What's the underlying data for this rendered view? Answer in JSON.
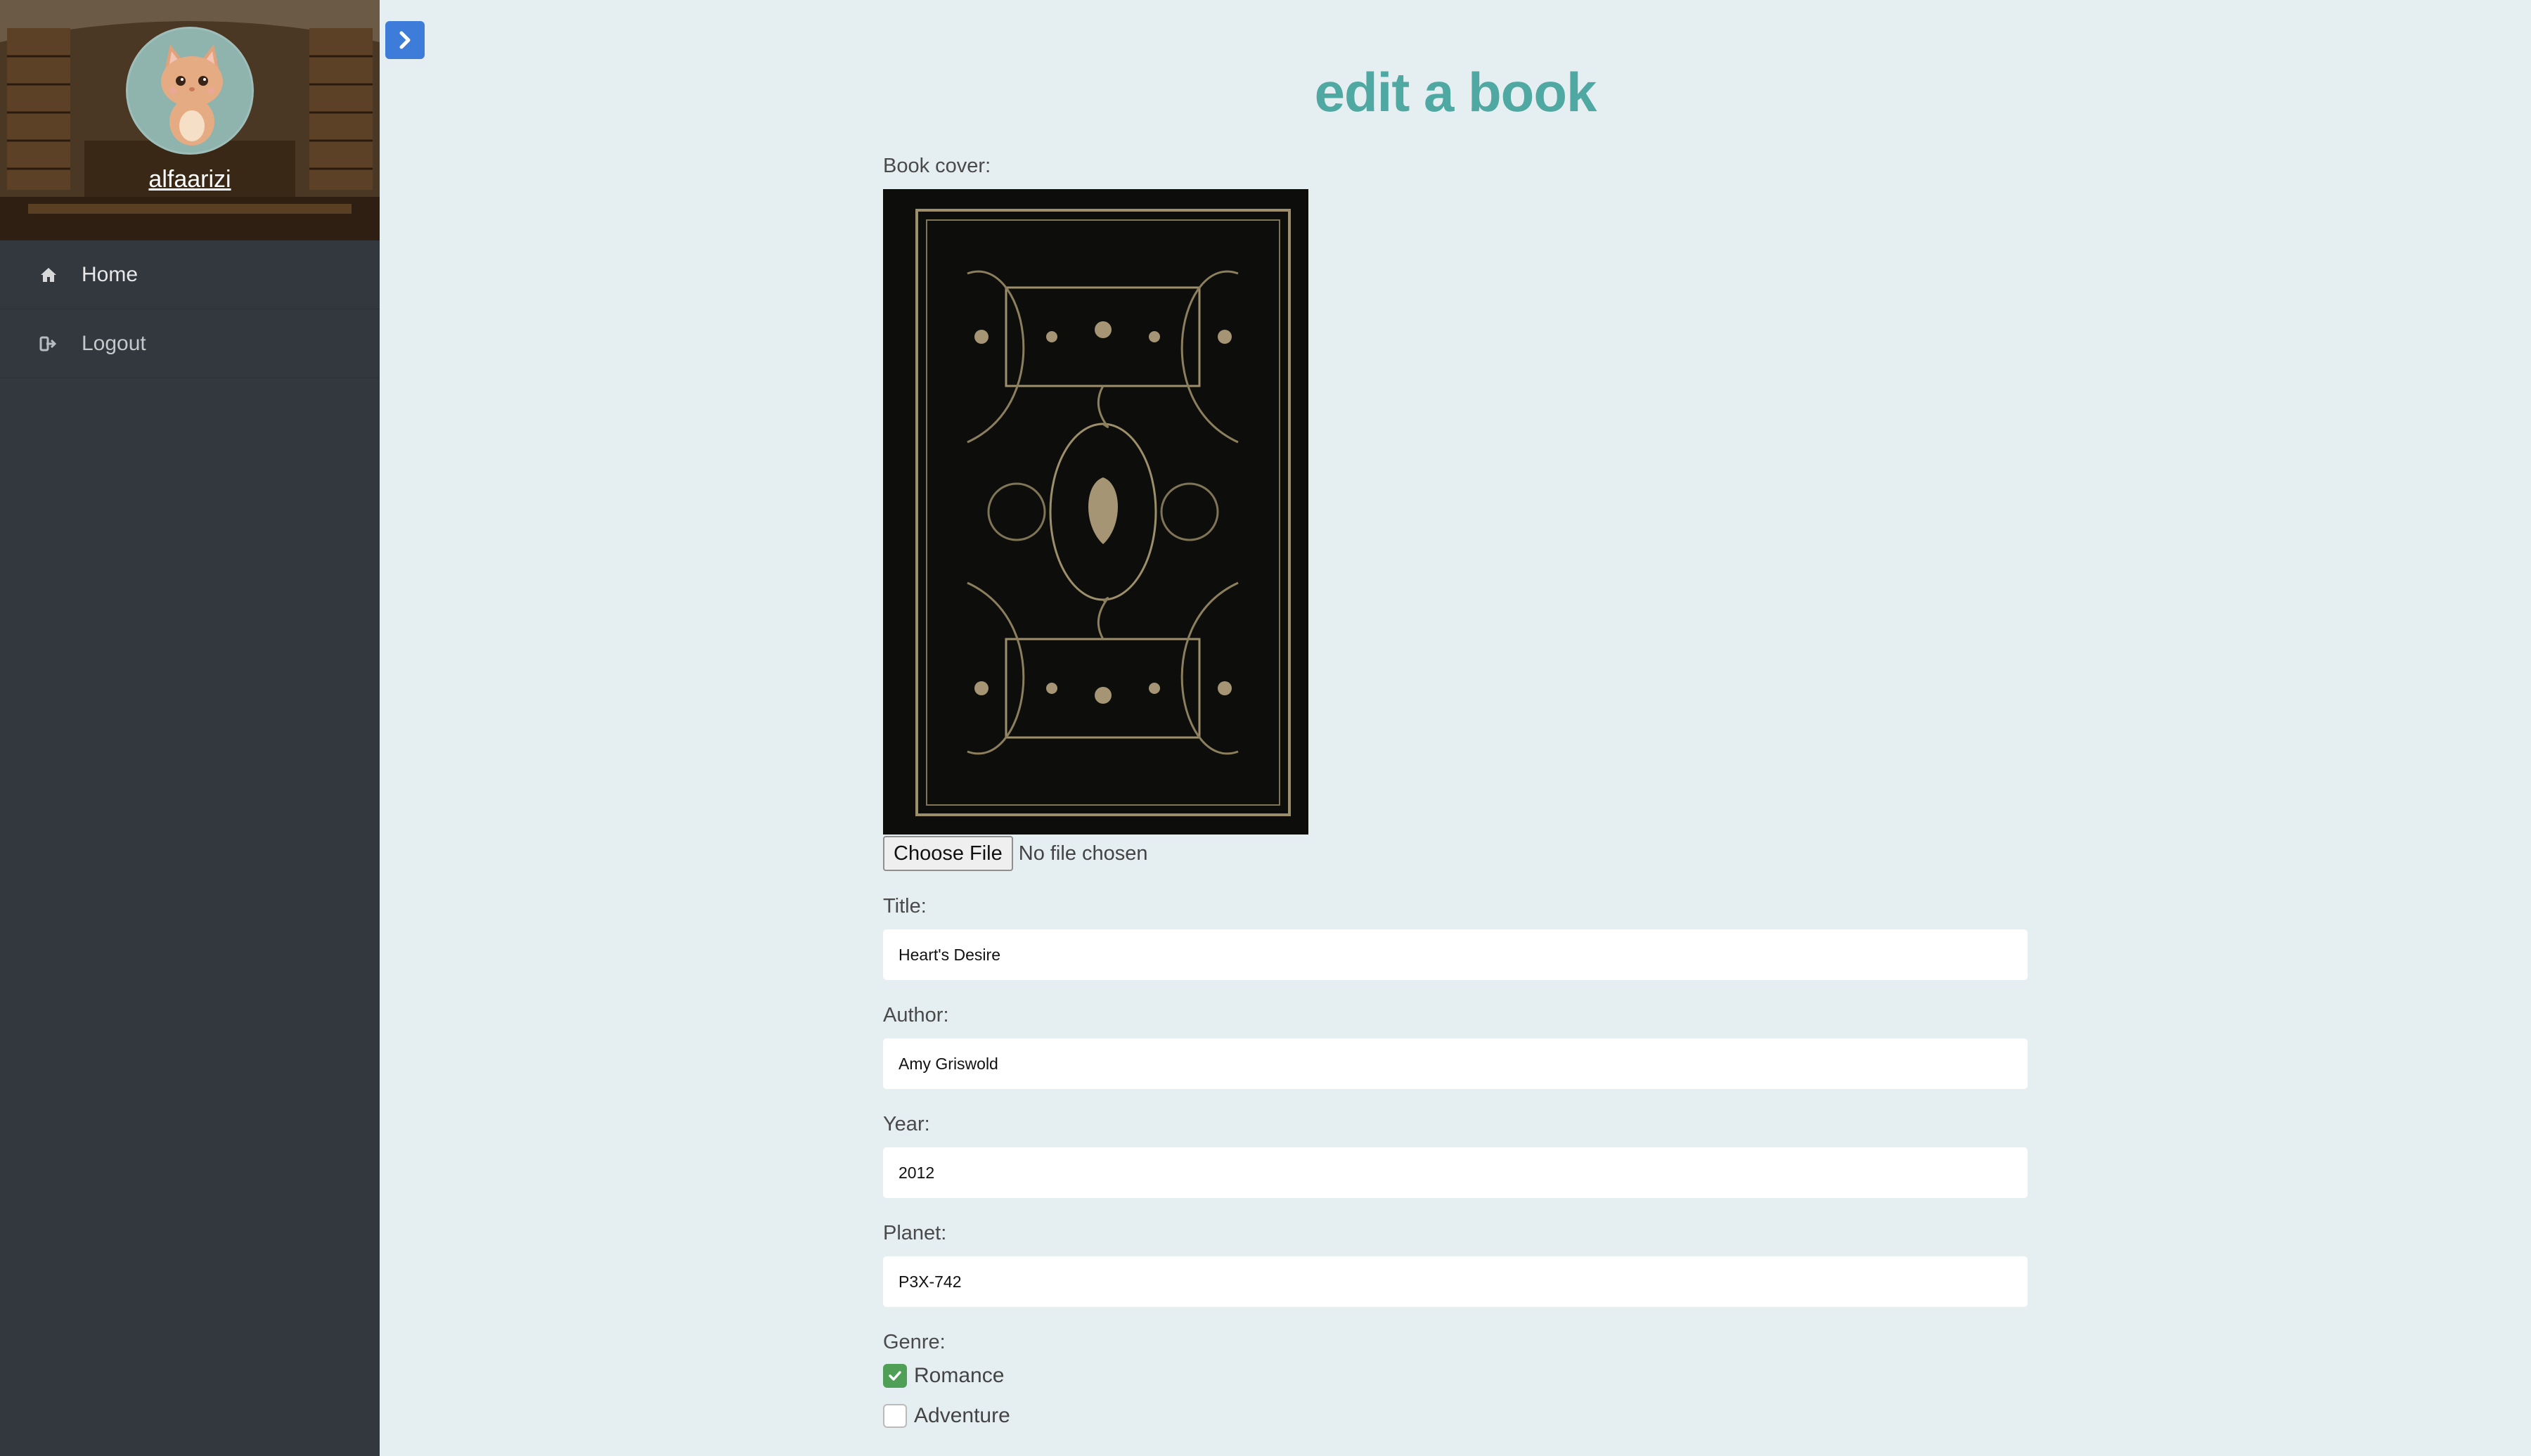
{
  "sidebar": {
    "username": "alfaarizi",
    "nav": [
      {
        "label": "Home",
        "icon": "home-icon"
      },
      {
        "label": "Logout",
        "icon": "logout-icon"
      }
    ]
  },
  "page": {
    "title": "edit a book"
  },
  "form": {
    "cover_label": "Book cover:",
    "file_button": "Choose File",
    "file_status": "No file chosen",
    "title_label": "Title:",
    "title_value": "Heart's Desire",
    "author_label": "Author:",
    "author_value": "Amy Griswold",
    "year_label": "Year:",
    "year_value": "2012",
    "planet_label": "Planet:",
    "planet_value": "P3X-742",
    "genre_label": "Genre:",
    "genres": [
      {
        "label": "Romance",
        "checked": true
      },
      {
        "label": "Adventure",
        "checked": false
      }
    ]
  },
  "colors": {
    "accent": "#4fa8a2",
    "sidebar": "#32383d",
    "toggle": "#3d7dd9",
    "checkbox": "#4f9f56"
  }
}
